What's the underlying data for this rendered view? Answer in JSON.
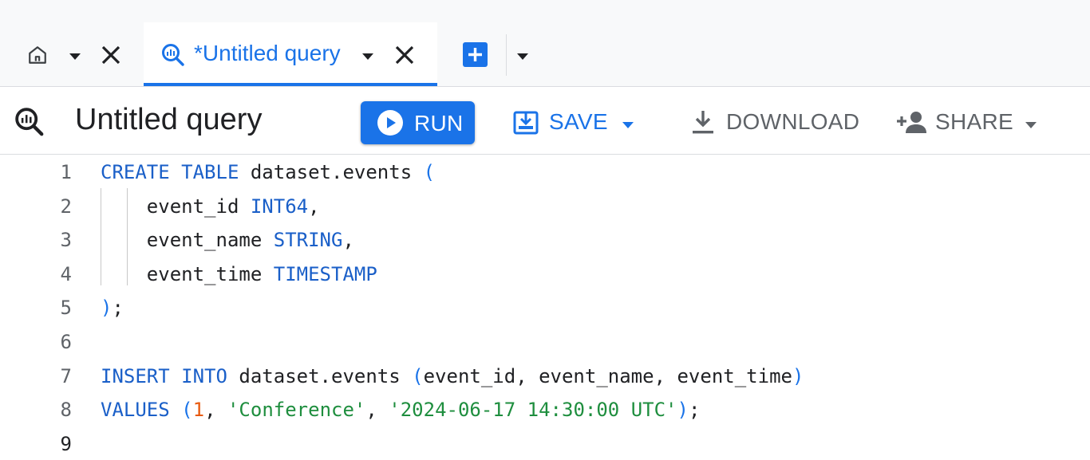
{
  "tabs": {
    "home_icon": "home-icon",
    "active_tab_label": "*Untitled query"
  },
  "toolbar": {
    "title": "Untitled query",
    "run_label": "RUN",
    "save_label": "SAVE",
    "download_label": "DOWNLOAD",
    "share_label": "SHARE"
  },
  "editor": {
    "line_numbers": [
      "1",
      "2",
      "3",
      "4",
      "5",
      "6",
      "7",
      "8",
      "9"
    ],
    "current_line": "9",
    "lines": [
      [
        {
          "t": "CREATE",
          "k": "kw"
        },
        {
          "t": " "
        },
        {
          "t": "TABLE",
          "k": "kw"
        },
        {
          "t": " dataset.events "
        },
        {
          "t": "(",
          "k": "pun"
        }
      ],
      [
        {
          "t": "    event_id "
        },
        {
          "t": "INT64",
          "k": "kw"
        },
        {
          "t": ","
        }
      ],
      [
        {
          "t": "    event_name "
        },
        {
          "t": "STRING",
          "k": "kw"
        },
        {
          "t": ","
        }
      ],
      [
        {
          "t": "    event_time "
        },
        {
          "t": "TIMESTAMP",
          "k": "kw"
        }
      ],
      [
        {
          "t": ")",
          "k": "pun"
        },
        {
          "t": ";"
        }
      ],
      [],
      [
        {
          "t": "INSERT",
          "k": "kw"
        },
        {
          "t": " "
        },
        {
          "t": "INTO",
          "k": "kw"
        },
        {
          "t": " dataset.events "
        },
        {
          "t": "(",
          "k": "pun"
        },
        {
          "t": "event_id, event_name, event_time"
        },
        {
          "t": ")",
          "k": "pun"
        }
      ],
      [
        {
          "t": "VALUES",
          "k": "kw"
        },
        {
          "t": " "
        },
        {
          "t": "(",
          "k": "pun"
        },
        {
          "t": "1",
          "k": "num"
        },
        {
          "t": ", "
        },
        {
          "t": "'Conference'",
          "k": "str"
        },
        {
          "t": ", "
        },
        {
          "t": "'2024-06-17 14:30:00 UTC'",
          "k": "str"
        },
        {
          "t": ")",
          "k": "pun"
        },
        {
          "t": ";"
        }
      ],
      []
    ]
  },
  "colors": {
    "accent": "#1a73e8",
    "keyword": "#1a5fc8",
    "number": "#e8590c",
    "string": "#1e8e3e"
  }
}
